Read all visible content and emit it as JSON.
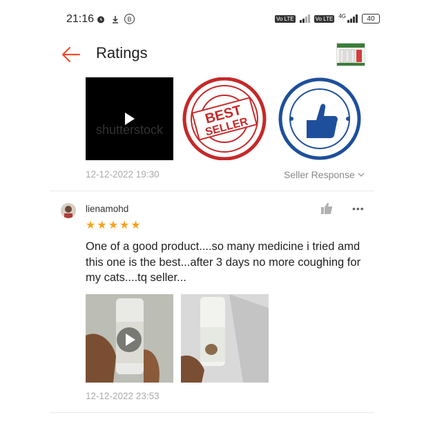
{
  "status_bar": {
    "time": "21:16",
    "network": "4G",
    "battery": "40",
    "volte1": "Vo LTE",
    "volte2": "Vo LTE"
  },
  "header": {
    "title": "Ratings"
  },
  "top_review": {
    "media_watermark": "shutterstock",
    "date": "12-12-2022 19:30",
    "seller_response_label": "Seller Response"
  },
  "review": {
    "username": "lienamohd",
    "rating": 5,
    "stars": "★★★★★",
    "text": "One of a good product....so many medicine i tried amd this one is the best...after 3 days no more coughing for my cats....tq seller...",
    "date": "12-12-2022 23:53"
  },
  "colors": {
    "accent": "#ee4d2d",
    "star": "#f7a21b",
    "muted": "#aaaaaa"
  },
  "icons": [
    "back-arrow-icon",
    "play-icon",
    "thumbs-up-icon",
    "more-icon",
    "chevron-down-icon",
    "alarm-icon",
    "download-icon",
    "b-badge-icon"
  ]
}
